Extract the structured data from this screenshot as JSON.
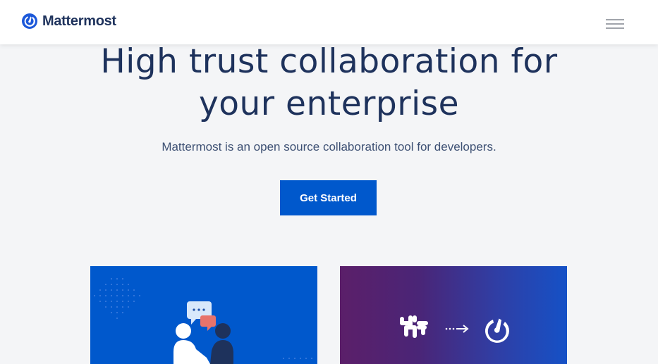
{
  "header": {
    "brand": "Mattermost",
    "logo_icon": "mattermost-logo-icon",
    "menu_icon": "hamburger-menu-icon"
  },
  "hero": {
    "title_line1": "High trust collaboration for",
    "title_line2": "your enterprise",
    "subtitle": "Mattermost is an open source collaboration tool for developers.",
    "cta_label": "Get Started"
  },
  "cards": [
    {
      "illustration": "chat-people-illustration",
      "background": "#0058cc"
    },
    {
      "illustration": "slack-to-mattermost-migration-illustration",
      "background": "#5b1f69"
    }
  ],
  "colors": {
    "brand_navy": "#1e325c",
    "accent_blue": "#0058cc",
    "page_bg": "#f4f5f7",
    "header_bg": "#ffffff"
  }
}
